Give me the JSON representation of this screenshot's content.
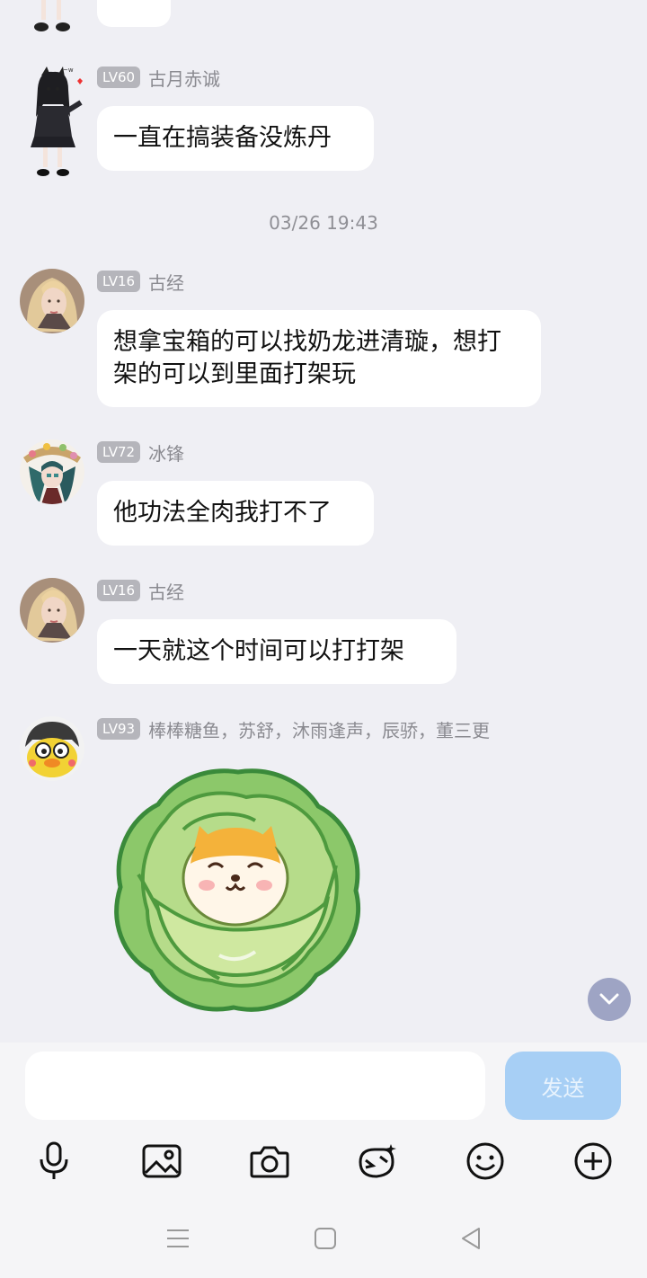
{
  "messages": [
    {
      "level": "LV60",
      "name": "古月赤诚",
      "text": "一直在搞装备没炼丹"
    },
    {
      "level": "LV16",
      "name": "古经",
      "text": "想拿宝箱的可以找奶龙进清璇，想打架的可以到里面打架玩"
    },
    {
      "level": "LV72",
      "name": "冰锋",
      "text": "他功法全肉我打不了"
    },
    {
      "level": "LV16",
      "name": "古经",
      "text": "一天就这个时间可以打打架"
    },
    {
      "level": "LV93",
      "name": "棒棒糖鱼，苏舒，沐雨逢声，辰骄，董三更",
      "sticker": "cabbage-shiba-sticker"
    }
  ],
  "timestamp": "03/26 19:43",
  "input": {
    "value": "",
    "placeholder": ""
  },
  "send_label": "发送",
  "toolbar": [
    "microphone-icon",
    "image-icon",
    "camera-icon",
    "emoji-sticker-icon",
    "smiley-icon",
    "plus-icon"
  ],
  "navbar": [
    "menu-icon",
    "home-icon",
    "back-icon"
  ],
  "colors": {
    "background": "#efeff4",
    "bubble": "#ffffff",
    "level_badge": "#b5b5bb",
    "send_button": "#a7cff5",
    "scroll_button": "#9ea4c4"
  }
}
